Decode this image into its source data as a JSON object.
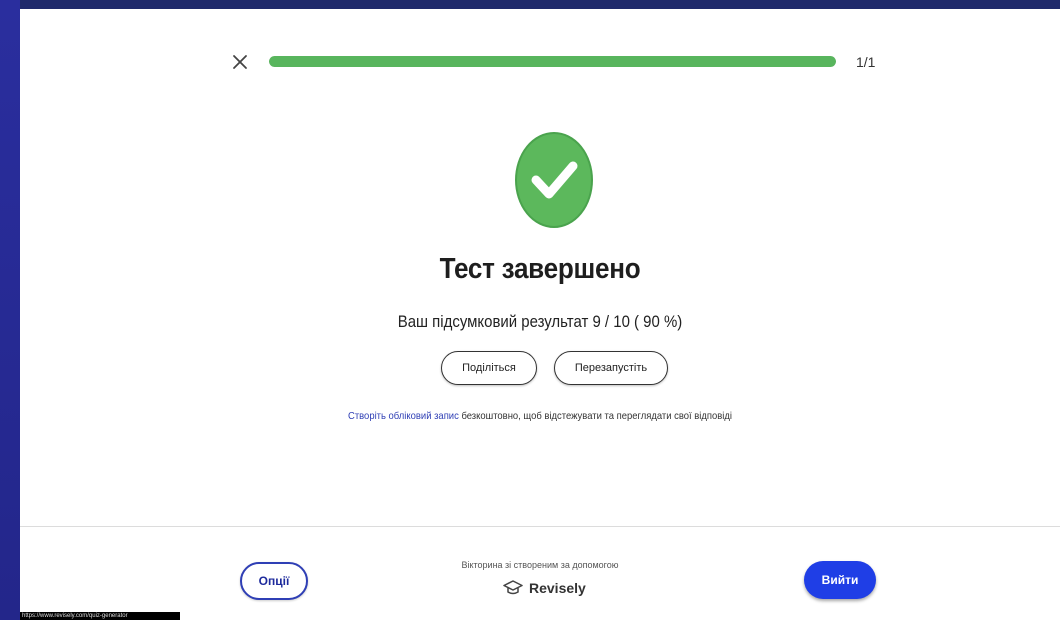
{
  "quiz": {
    "progress": 1.0,
    "progress_label": "1/1",
    "title": "Тест завершено",
    "score_text": "Ваш підсумковий результат 9 / 10 ( 90 %)",
    "share_label": "Поділіться",
    "restart_label": "Перезапустіть",
    "signup_link": "Створіть обліковий запис",
    "signup_rest": " безкоштовно, щоб відстежувати та переглядати свої відповіді"
  },
  "footer": {
    "options_label": "Опції",
    "exit_label": "Вийти",
    "made_with": "Вікторина зі створеним за допомогою",
    "brand": "Revisely"
  },
  "status_url": "https://www.revisely.com/quiz-generator",
  "colors": {
    "progress": "#58b55d",
    "accent_blue": "#1f3ee6",
    "background": "#2b2d8f"
  },
  "icons": [
    "close-icon",
    "checkmark-icon",
    "graduation-cap-icon"
  ]
}
